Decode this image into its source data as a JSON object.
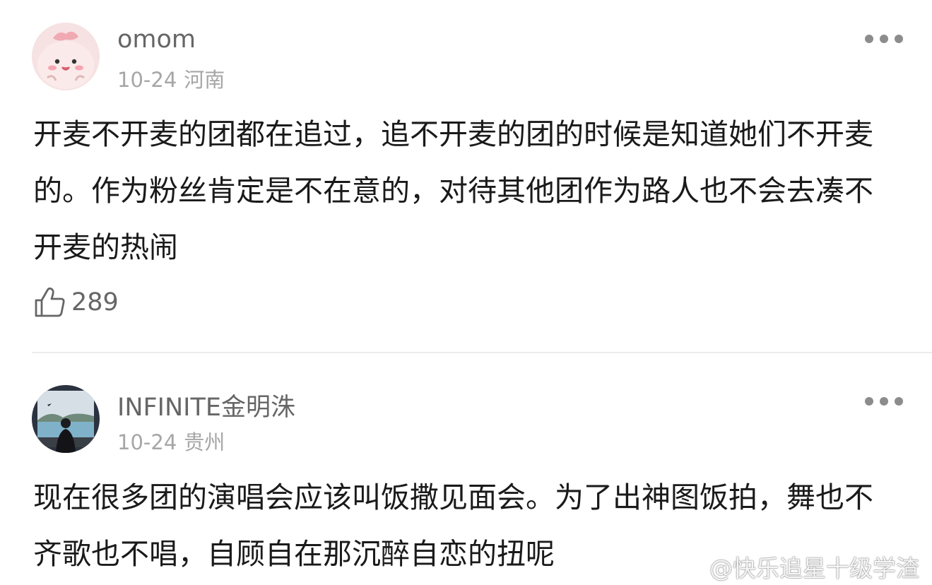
{
  "comments": [
    {
      "username": "omom",
      "date": "10-24",
      "location": "河南",
      "text": "开麦不开麦的团都在追过，追不开麦的团的时候是知道她们不开麦的。作为粉丝肯定是不在意的，对待其他团作为路人也不会去凑不开麦的热闹",
      "likes": "289",
      "avatar": "pink-cartoon-avatar"
    },
    {
      "username": "INFINITE金明洙",
      "date": "10-24",
      "location": "贵州",
      "text": "现在很多团的演唱会应该叫饭撒见面会。为了出神图饭拍，舞也不齐歌也不唱，自顾自在那沉醉自恋的扭呢",
      "avatar": "photo-avatar"
    }
  ],
  "watermark": "@快乐追星十级学渣",
  "icons": {
    "more": "more-dots-icon",
    "like": "thumbs-up-icon",
    "watermark": "weibo-logo-icon"
  },
  "colors": {
    "username": "#666666",
    "meta": "#a6a6a6",
    "text": "#1a1a1a",
    "divider": "#ececec"
  }
}
